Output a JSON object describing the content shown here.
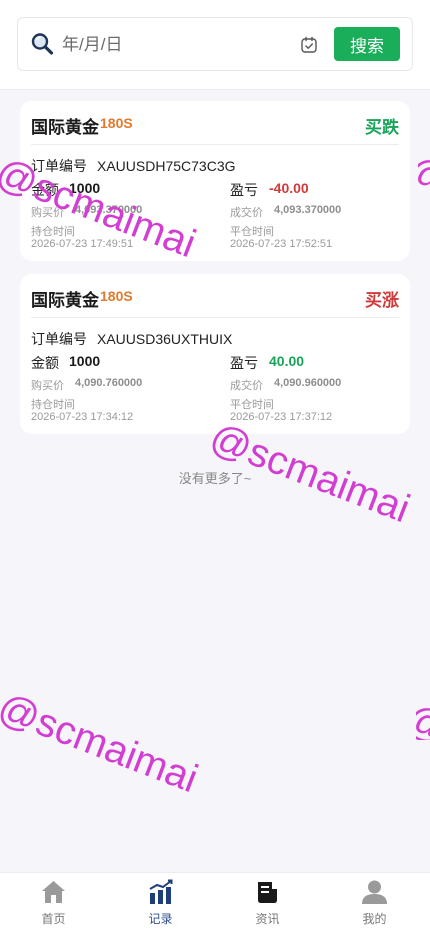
{
  "search": {
    "placeholder": "年/月/日",
    "button_label": "搜索"
  },
  "orders": [
    {
      "product": "国际黄金",
      "duration": "180S",
      "direction": "买跌",
      "direction_color": "#1aa35a",
      "order_label": "订单编号",
      "order_no": "XAUUSDH75C73C3G",
      "amount_label": "金额",
      "amount": "1000",
      "pnl_label": "盈亏",
      "pnl": "-40.00",
      "pnl_color": "#d03a3a",
      "buy_price_label": "购买价",
      "buy_price": "4,093.370000",
      "deal_price_label": "成交价",
      "deal_price": "4,093.370000",
      "open_time_label": "持仓时间",
      "open_time": "2026-07-23 17:49:51",
      "close_time_label": "平仓时间",
      "close_time": "2026-07-23 17:52:51"
    },
    {
      "product": "国际黄金",
      "duration": "180S",
      "direction": "买涨",
      "direction_color": "#d03a3a",
      "order_label": "订单编号",
      "order_no": "XAUUSD36UXTHUIX",
      "amount_label": "金额",
      "amount": "1000",
      "pnl_label": "盈亏",
      "pnl": "40.00",
      "pnl_color": "#1aa35a",
      "buy_price_label": "购买价",
      "buy_price": "4,090.760000",
      "deal_price_label": "成交价",
      "deal_price": "4,090.960000",
      "open_time_label": "持仓时间",
      "open_time": "2026-07-23 17:34:12",
      "close_time_label": "平仓时间",
      "close_time": "2026-07-23 17:37:12"
    }
  ],
  "list_end_text": "没有更多了~",
  "watermark_text": "@scmaimai",
  "nav": {
    "items": [
      {
        "label": "首页",
        "icon": "home-icon"
      },
      {
        "label": "记录",
        "icon": "chart-icon",
        "active": true
      },
      {
        "label": "资讯",
        "icon": "news-icon"
      },
      {
        "label": "我的",
        "icon": "user-icon"
      }
    ],
    "active_color": "#2b4d8f"
  }
}
